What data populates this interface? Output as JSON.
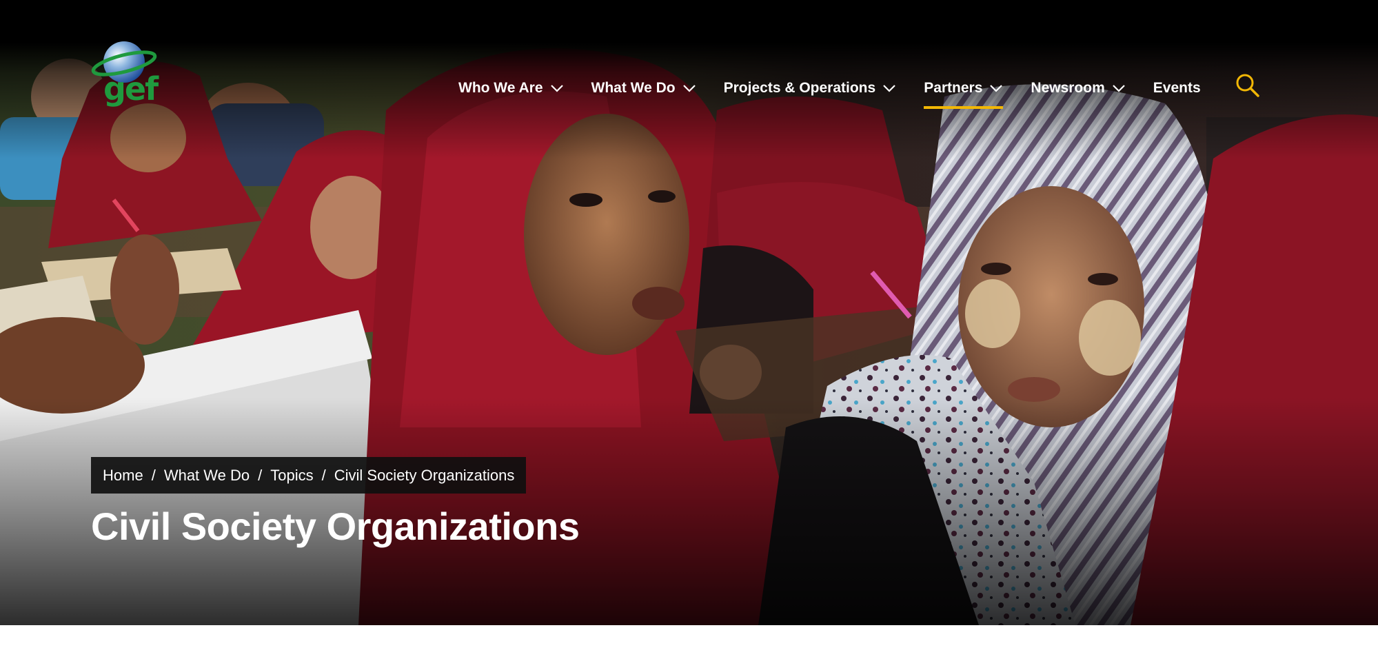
{
  "logo": {
    "text": "gef"
  },
  "nav": {
    "items": [
      {
        "label": "Who We Are",
        "has_dropdown": true,
        "active": false
      },
      {
        "label": "What We Do",
        "has_dropdown": true,
        "active": false
      },
      {
        "label": "Projects & Operations",
        "has_dropdown": true,
        "active": false
      },
      {
        "label": "Partners",
        "has_dropdown": true,
        "active": true
      },
      {
        "label": "Newsroom",
        "has_dropdown": true,
        "active": false
      },
      {
        "label": "Events",
        "has_dropdown": false,
        "active": false
      }
    ],
    "search_icon": "search-icon"
  },
  "breadcrumb": {
    "items": [
      {
        "label": "Home"
      },
      {
        "label": "What We Do"
      },
      {
        "label": "Topics"
      },
      {
        "label": "Civil Society Organizations"
      }
    ],
    "separator": "/"
  },
  "page_title": "Civil Society Organizations",
  "colors": {
    "accent": "#f2b705",
    "logo_green": "#1f9a3e",
    "header_bg": "#000000",
    "text": "#ffffff"
  }
}
